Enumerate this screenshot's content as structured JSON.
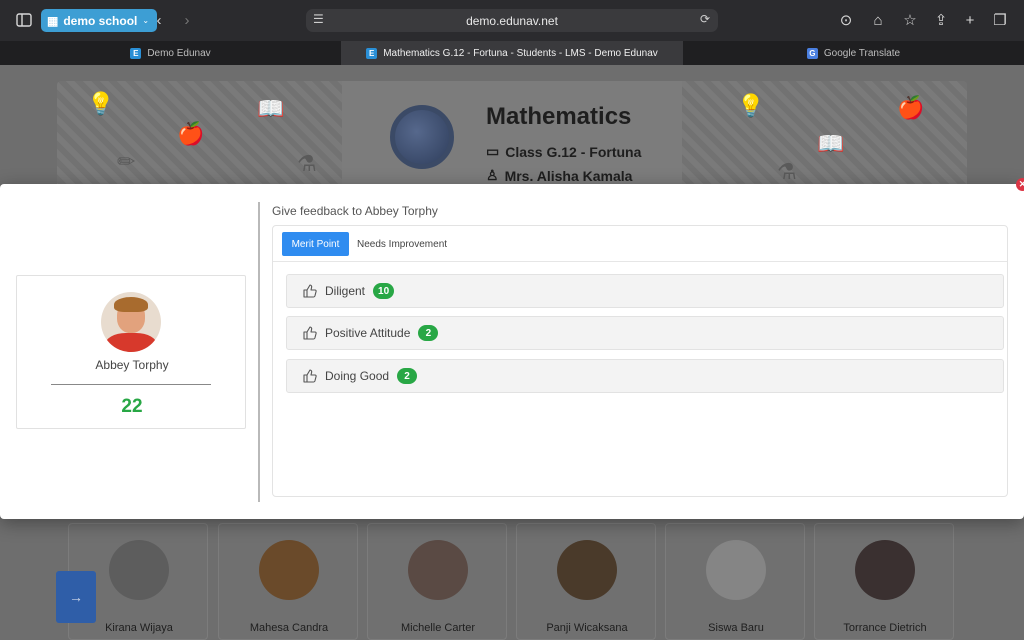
{
  "browser": {
    "profile_label": "demo school",
    "url": "demo.edunav.net",
    "tabs": [
      {
        "label": "Demo Edunav"
      },
      {
        "label": "Mathematics G.12 - Fortuna - Students - LMS - Demo Edunav"
      },
      {
        "label": "Google Translate"
      }
    ]
  },
  "course": {
    "title": "Mathematics",
    "class_label": "Class G.12 - Fortuna",
    "teacher": "Mrs. Alisha Kamala"
  },
  "students": [
    {
      "name": "Kirana Wijaya"
    },
    {
      "name": "Mahesa Candra"
    },
    {
      "name": "Michelle Carter"
    },
    {
      "name": "Panji Wicaksana"
    },
    {
      "name": "Siswa Baru"
    },
    {
      "name": "Torrance Dietrich"
    }
  ],
  "modal": {
    "student_name": "Abbey Torphy",
    "points": "22",
    "feedback_title": "Give feedback to Abbey Torphy",
    "tab_merit": "Merit Point",
    "tab_needs": "Needs Improvement",
    "merit_items": [
      {
        "label": "Diligent",
        "count": "10"
      },
      {
        "label": "Positive Attitude",
        "count": "2"
      },
      {
        "label": "Doing Good",
        "count": "2"
      }
    ],
    "accent_color": "#2f8cf0",
    "success_color": "#28a745"
  }
}
